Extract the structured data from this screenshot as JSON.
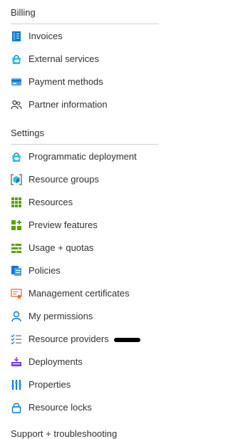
{
  "billing": {
    "header": "Billing",
    "items": [
      {
        "label": "Invoices",
        "icon": "invoice-icon"
      },
      {
        "label": "External services",
        "icon": "external-services-icon"
      },
      {
        "label": "Payment methods",
        "icon": "payment-card-icon"
      },
      {
        "label": "Partner information",
        "icon": "partner-people-icon"
      }
    ]
  },
  "settings": {
    "header": "Settings",
    "items": [
      {
        "label": "Programmatic deployment",
        "icon": "programmatic-deployment-icon"
      },
      {
        "label": "Resource groups",
        "icon": "resource-groups-icon"
      },
      {
        "label": "Resources",
        "icon": "resources-grid-icon"
      },
      {
        "label": "Preview features",
        "icon": "preview-features-icon"
      },
      {
        "label": "Usage + quotas",
        "icon": "usage-quotas-icon"
      },
      {
        "label": "Policies",
        "icon": "policies-icon"
      },
      {
        "label": "Management certificates",
        "icon": "certificate-icon"
      },
      {
        "label": "My permissions",
        "icon": "person-icon"
      },
      {
        "label": "Resource providers",
        "icon": "resource-providers-icon"
      },
      {
        "label": "Deployments",
        "icon": "deployments-icon"
      },
      {
        "label": "Properties",
        "icon": "properties-icon"
      },
      {
        "label": "Resource locks",
        "icon": "lock-icon"
      }
    ]
  },
  "support": {
    "header": "Support + troubleshooting"
  }
}
